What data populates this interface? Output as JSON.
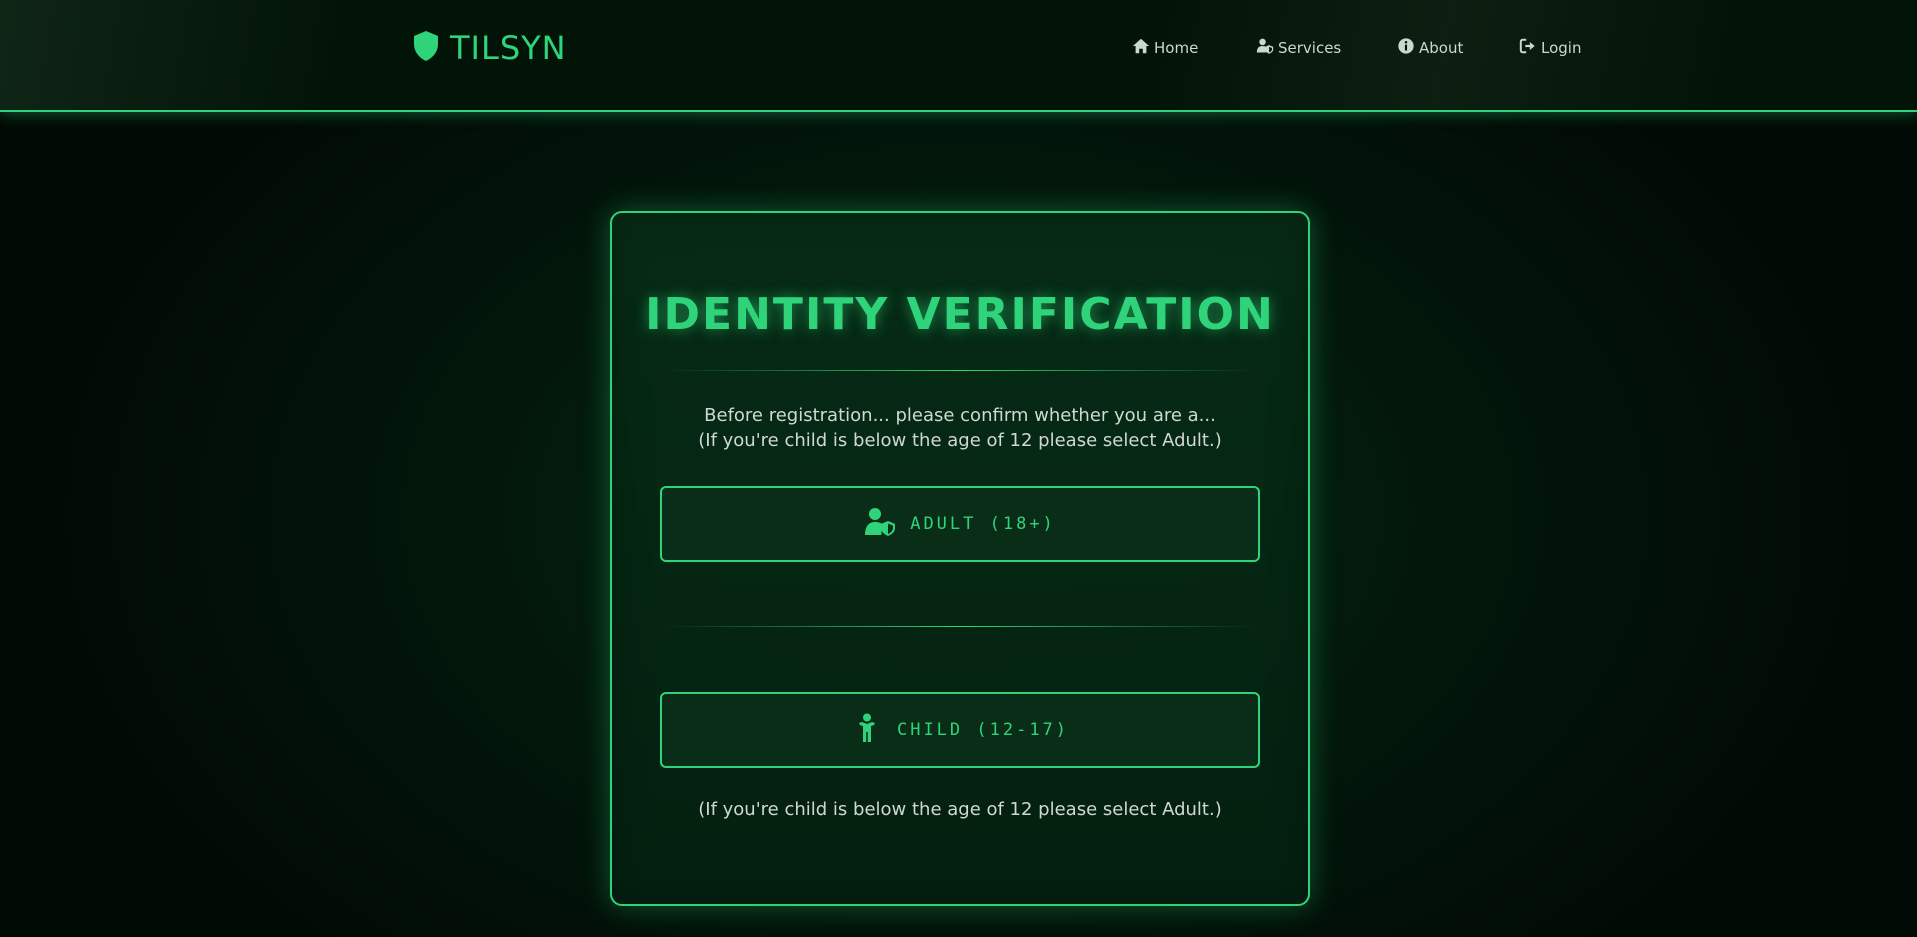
{
  "brand": {
    "name": "TILSYN",
    "icon": "shield-icon"
  },
  "nav": {
    "home": {
      "label": "Home",
      "icon": "home-icon"
    },
    "services": {
      "label": "Services",
      "icon": "user-shield-icon"
    },
    "about": {
      "label": "About",
      "icon": "info-circle-icon"
    },
    "login": {
      "label": "Login",
      "icon": "sign-in-icon"
    }
  },
  "card": {
    "title": "IDENTITY VERIFICATION",
    "intro_line1": "Before registration... please confirm whether you are a...",
    "intro_line2": "(If you're child is below the age of 12 please select Adult.)",
    "adult_label": "ADULT (18+)",
    "child_label": "CHILD (12-17)",
    "note": "(If you're child is below the age of 12 please select Adult.)"
  },
  "colors": {
    "accent": "#2fd47a",
    "background": "#010d06",
    "text": "#cfd8d2"
  }
}
